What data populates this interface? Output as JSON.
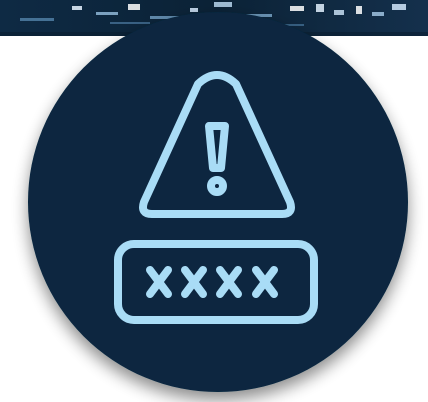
{
  "graphic": {
    "icon_names": [
      "warning-triangle-icon",
      "masked-password-field-icon"
    ],
    "masked_password_glyphs": 4
  },
  "colors": {
    "page_background": "#ffffff",
    "banner_base": "#0b2236",
    "circle_fill": "#07283f",
    "icon_stroke": "#a9dcf6",
    "shadow": "#9aa3aa"
  }
}
